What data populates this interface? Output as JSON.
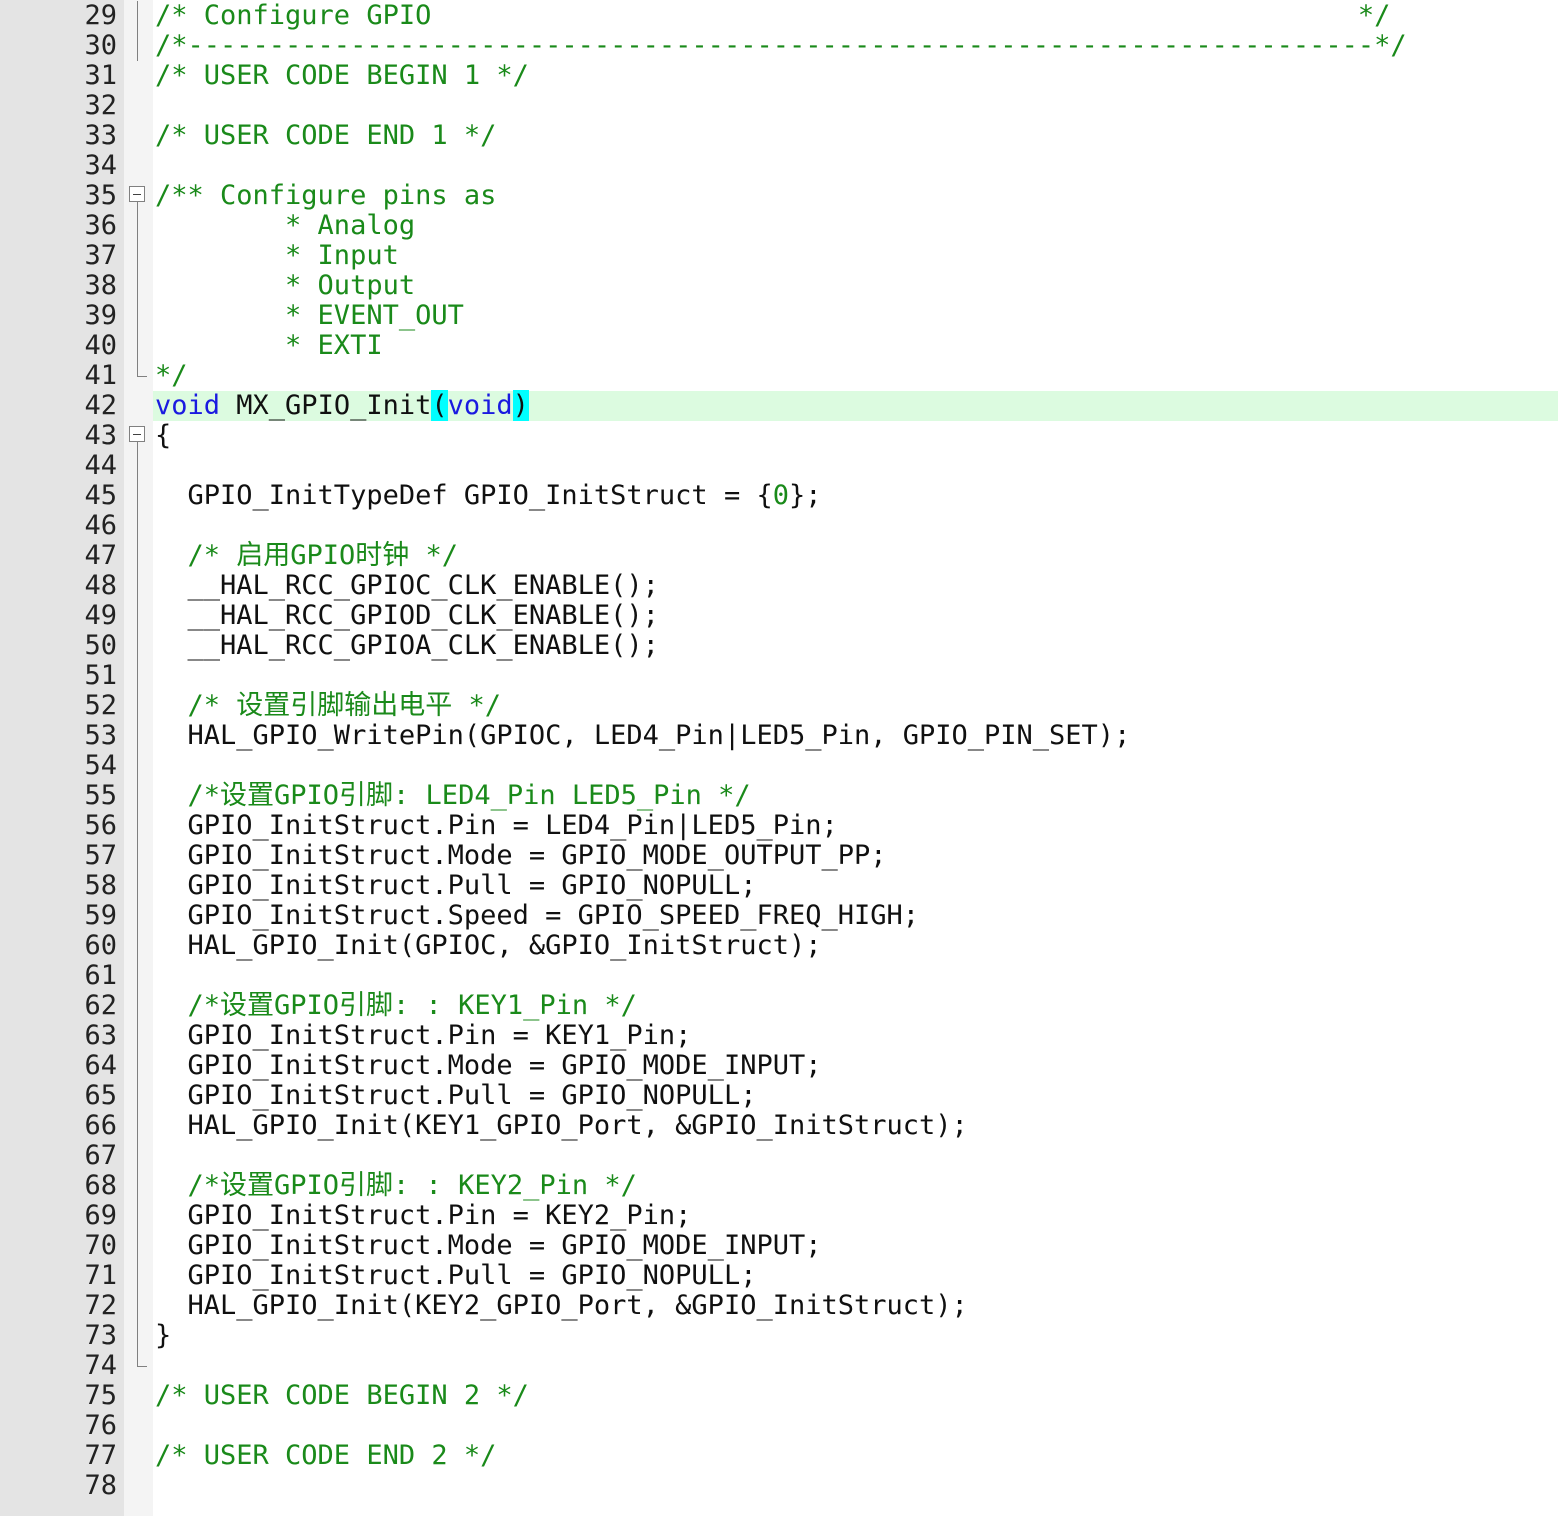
{
  "editor": {
    "current_line": 42,
    "colors": {
      "comment": "#1a8a1a",
      "keyword": "#1a1ae0",
      "current_line_bg": "#dcfbe0",
      "brace_match_bg": "#00ffff",
      "gutter_bg": "#e4e4e4"
    },
    "lines": [
      {
        "n": "29",
        "fold": "line",
        "segments": [
          {
            "t": "/* Configure GPIO                                                         */",
            "c": "comment"
          }
        ]
      },
      {
        "n": "30",
        "fold": "line",
        "segments": [
          {
            "t": "/*-------------------------------------------------------------------------*/",
            "c": "comment"
          }
        ]
      },
      {
        "n": "31",
        "fold": "",
        "segments": [
          {
            "t": "/* USER CODE BEGIN 1 */",
            "c": "comment"
          }
        ]
      },
      {
        "n": "32",
        "fold": "",
        "segments": []
      },
      {
        "n": "33",
        "fold": "",
        "segments": [
          {
            "t": "/* USER CODE END 1 */",
            "c": "comment"
          }
        ]
      },
      {
        "n": "34",
        "fold": "",
        "segments": []
      },
      {
        "n": "35",
        "fold": "open",
        "segments": [
          {
            "t": "/** Configure pins as",
            "c": "comment"
          }
        ]
      },
      {
        "n": "36",
        "fold": "line",
        "segments": [
          {
            "t": "        * Analog",
            "c": "comment"
          }
        ]
      },
      {
        "n": "37",
        "fold": "line",
        "segments": [
          {
            "t": "        * Input",
            "c": "comment"
          }
        ]
      },
      {
        "n": "38",
        "fold": "line",
        "segments": [
          {
            "t": "        * Output",
            "c": "comment"
          }
        ]
      },
      {
        "n": "39",
        "fold": "line",
        "segments": [
          {
            "t": "        * EVENT_OUT",
            "c": "comment"
          }
        ]
      },
      {
        "n": "40",
        "fold": "line",
        "segments": [
          {
            "t": "        * EXTI",
            "c": "comment"
          }
        ]
      },
      {
        "n": "41",
        "fold": "end",
        "segments": [
          {
            "t": "*/",
            "c": "comment"
          }
        ]
      },
      {
        "n": "42",
        "fold": "",
        "segments": [
          {
            "t": "void",
            "c": "kw"
          },
          {
            "t": " MX_GPIO_Init",
            "c": ""
          },
          {
            "t": "(",
            "c": "hl"
          },
          {
            "t": "void",
            "c": "kw"
          },
          {
            "t": ")",
            "c": "hl"
          }
        ]
      },
      {
        "n": "43",
        "fold": "open",
        "segments": [
          {
            "t": "{",
            "c": ""
          }
        ]
      },
      {
        "n": "44",
        "fold": "line",
        "segments": []
      },
      {
        "n": "45",
        "fold": "line",
        "segments": [
          {
            "t": "  GPIO_InitTypeDef GPIO_InitStruct = {",
            "c": ""
          },
          {
            "t": "0",
            "c": "num"
          },
          {
            "t": "};",
            "c": ""
          }
        ]
      },
      {
        "n": "46",
        "fold": "line",
        "segments": []
      },
      {
        "n": "47",
        "fold": "line",
        "segments": [
          {
            "t": "  /* 启用GPIO时钟 */",
            "c": "comment"
          }
        ]
      },
      {
        "n": "48",
        "fold": "line",
        "segments": [
          {
            "t": "  __HAL_RCC_GPIOC_CLK_ENABLE();",
            "c": ""
          }
        ]
      },
      {
        "n": "49",
        "fold": "line",
        "segments": [
          {
            "t": "  __HAL_RCC_GPIOD_CLK_ENABLE();",
            "c": ""
          }
        ]
      },
      {
        "n": "50",
        "fold": "line",
        "segments": [
          {
            "t": "  __HAL_RCC_GPIOA_CLK_ENABLE();",
            "c": ""
          }
        ]
      },
      {
        "n": "51",
        "fold": "line",
        "segments": []
      },
      {
        "n": "52",
        "fold": "line",
        "segments": [
          {
            "t": "  /* 设置引脚输出电平 */",
            "c": "comment"
          }
        ]
      },
      {
        "n": "53",
        "fold": "line",
        "segments": [
          {
            "t": "  HAL_GPIO_WritePin(GPIOC, LED4_Pin|LED5_Pin, GPIO_PIN_SET);",
            "c": ""
          }
        ]
      },
      {
        "n": "54",
        "fold": "line",
        "segments": []
      },
      {
        "n": "55",
        "fold": "line",
        "segments": [
          {
            "t": "  /*设置GPIO引脚: LED4_Pin LED5_Pin */",
            "c": "comment"
          }
        ]
      },
      {
        "n": "56",
        "fold": "line",
        "segments": [
          {
            "t": "  GPIO_InitStruct.Pin = LED4_Pin|LED5_Pin;",
            "c": ""
          }
        ]
      },
      {
        "n": "57",
        "fold": "line",
        "segments": [
          {
            "t": "  GPIO_InitStruct.Mode = GPIO_MODE_OUTPUT_PP;",
            "c": ""
          }
        ]
      },
      {
        "n": "58",
        "fold": "line",
        "segments": [
          {
            "t": "  GPIO_InitStruct.Pull = GPIO_NOPULL;",
            "c": ""
          }
        ]
      },
      {
        "n": "59",
        "fold": "line",
        "segments": [
          {
            "t": "  GPIO_InitStruct.Speed = GPIO_SPEED_FREQ_HIGH;",
            "c": ""
          }
        ]
      },
      {
        "n": "60",
        "fold": "line",
        "segments": [
          {
            "t": "  HAL_GPIO_Init(GPIOC, &GPIO_InitStruct);",
            "c": ""
          }
        ]
      },
      {
        "n": "61",
        "fold": "line",
        "segments": []
      },
      {
        "n": "62",
        "fold": "line",
        "segments": [
          {
            "t": "  /*设置GPIO引脚: : KEY1_Pin */",
            "c": "comment"
          }
        ]
      },
      {
        "n": "63",
        "fold": "line",
        "segments": [
          {
            "t": "  GPIO_InitStruct.Pin = KEY1_Pin;",
            "c": ""
          }
        ]
      },
      {
        "n": "64",
        "fold": "line",
        "segments": [
          {
            "t": "  GPIO_InitStruct.Mode = GPIO_MODE_INPUT;",
            "c": ""
          }
        ]
      },
      {
        "n": "65",
        "fold": "line",
        "segments": [
          {
            "t": "  GPIO_InitStruct.Pull = GPIO_NOPULL;",
            "c": ""
          }
        ]
      },
      {
        "n": "66",
        "fold": "line",
        "segments": [
          {
            "t": "  HAL_GPIO_Init(KEY1_GPIO_Port, &GPIO_InitStruct);",
            "c": ""
          }
        ]
      },
      {
        "n": "67",
        "fold": "line",
        "segments": []
      },
      {
        "n": "68",
        "fold": "line",
        "segments": [
          {
            "t": "  /*设置GPIO引脚: : KEY2_Pin */",
            "c": "comment"
          }
        ]
      },
      {
        "n": "69",
        "fold": "line",
        "segments": [
          {
            "t": "  GPIO_InitStruct.Pin = KEY2_Pin;",
            "c": ""
          }
        ]
      },
      {
        "n": "70",
        "fold": "line",
        "segments": [
          {
            "t": "  GPIO_InitStruct.Mode = GPIO_MODE_INPUT;",
            "c": ""
          }
        ]
      },
      {
        "n": "71",
        "fold": "line",
        "segments": [
          {
            "t": "  GPIO_InitStruct.Pull = GPIO_NOPULL;",
            "c": ""
          }
        ]
      },
      {
        "n": "72",
        "fold": "line",
        "segments": [
          {
            "t": "  HAL_GPIO_Init(KEY2_GPIO_Port, &GPIO_InitStruct);",
            "c": ""
          }
        ]
      },
      {
        "n": "73",
        "fold": "line",
        "segments": [
          {
            "t": "}",
            "c": ""
          }
        ]
      },
      {
        "n": "74",
        "fold": "end",
        "segments": []
      },
      {
        "n": "75",
        "fold": "",
        "segments": [
          {
            "t": "/* USER CODE BEGIN 2 */",
            "c": "comment"
          }
        ]
      },
      {
        "n": "76",
        "fold": "",
        "segments": []
      },
      {
        "n": "77",
        "fold": "",
        "segments": [
          {
            "t": "/* USER CODE END 2 */",
            "c": "comment"
          }
        ]
      },
      {
        "n": "78",
        "fold": "",
        "segments": []
      }
    ]
  }
}
